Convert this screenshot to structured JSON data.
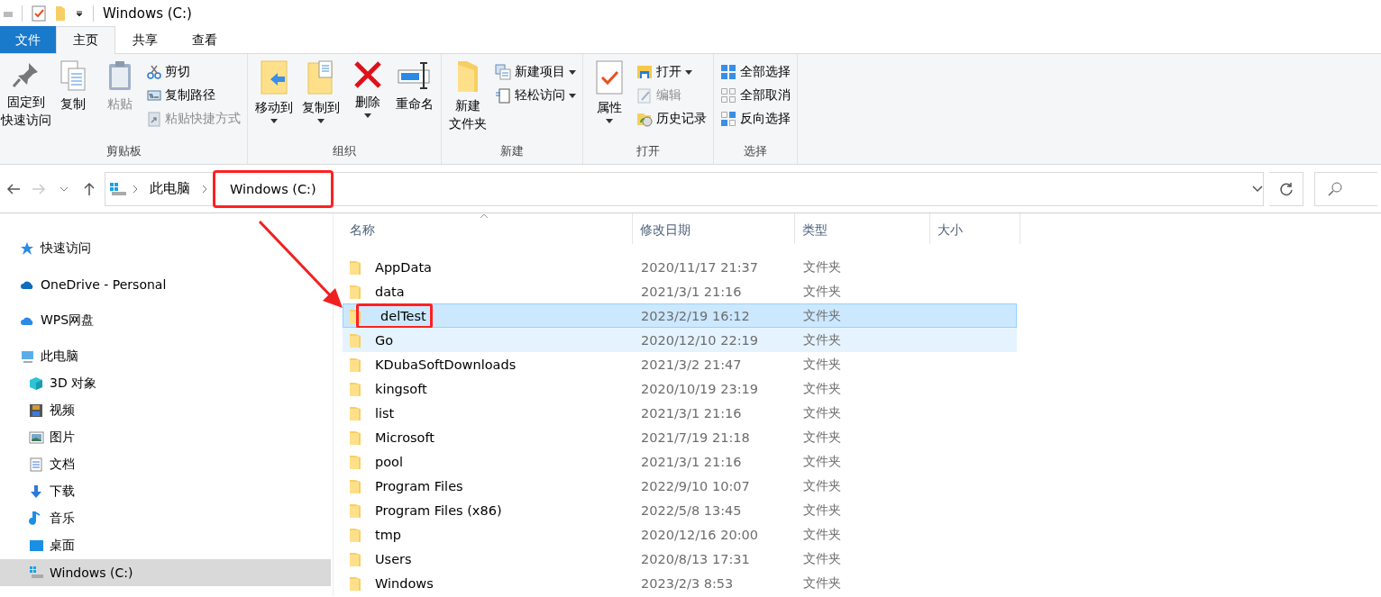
{
  "window": {
    "title": "Windows (C:)"
  },
  "ribbon_tabs": [
    {
      "label": "文件",
      "kind": "file",
      "selected": false
    },
    {
      "label": "主页",
      "kind": "tab",
      "selected": true
    },
    {
      "label": "共享",
      "kind": "tab",
      "selected": false
    },
    {
      "label": "查看",
      "kind": "tab",
      "selected": false
    }
  ],
  "ribbon_groups": [
    {
      "label": "剪贴板",
      "items": [
        {
          "kind": "large",
          "label": [
            "固定到",
            "快速访问"
          ],
          "disabled": false,
          "has_menu": false
        },
        {
          "kind": "large",
          "label": "复制",
          "disabled": false,
          "has_menu": false
        },
        {
          "kind": "large",
          "label": "粘贴",
          "disabled": true,
          "has_menu": false
        },
        {
          "kind": "small",
          "label": "剪切",
          "disabled": false,
          "has_menu": false
        },
        {
          "kind": "small",
          "label": "复制路径",
          "disabled": false,
          "has_menu": false
        },
        {
          "kind": "small",
          "label": "粘贴快捷方式",
          "disabled": true,
          "has_menu": false
        }
      ]
    },
    {
      "label": "组织",
      "items": [
        {
          "kind": "large",
          "label": "移动到",
          "disabled": false,
          "has_menu": true
        },
        {
          "kind": "large",
          "label": "复制到",
          "disabled": false,
          "has_menu": true
        },
        {
          "kind": "large",
          "label": "删除",
          "disabled": false,
          "has_menu": true
        },
        {
          "kind": "large",
          "label": "重命名",
          "disabled": false,
          "has_menu": false
        }
      ]
    },
    {
      "label": "新建",
      "items": [
        {
          "kind": "large",
          "label": [
            "新建",
            "文件夹"
          ],
          "disabled": false,
          "has_menu": false
        },
        {
          "kind": "small",
          "label": "新建项目",
          "disabled": false,
          "has_menu": true
        },
        {
          "kind": "small",
          "label": "轻松访问",
          "disabled": false,
          "has_menu": true
        }
      ]
    },
    {
      "label": "打开",
      "items": [
        {
          "kind": "large",
          "label": "属性",
          "disabled": false,
          "has_menu": true
        },
        {
          "kind": "small",
          "label": "打开",
          "disabled": false,
          "has_menu": true
        },
        {
          "kind": "small",
          "label": "编辑",
          "disabled": true,
          "has_menu": false
        },
        {
          "kind": "small",
          "label": "历史记录",
          "disabled": false,
          "has_menu": false
        }
      ]
    },
    {
      "label": "选择",
      "items": [
        {
          "kind": "small",
          "label": "全部选择",
          "disabled": false,
          "has_menu": false
        },
        {
          "kind": "small",
          "label": "全部取消",
          "disabled": false,
          "has_menu": false
        },
        {
          "kind": "small",
          "label": "反向选择",
          "disabled": false,
          "has_menu": false
        }
      ]
    }
  ],
  "address_bar": {
    "breadcrumbs": [
      {
        "label": "此电脑",
        "annotated": false
      },
      {
        "label": "Windows (C:)",
        "annotated": true
      }
    ]
  },
  "sidebar": {
    "items": [
      {
        "label": "快速访问",
        "selected": false
      },
      {
        "label": "OneDrive - Personal",
        "selected": false
      },
      {
        "label": "WPS网盘",
        "selected": false
      },
      {
        "label": "此电脑",
        "selected": false,
        "children": [
          {
            "label": "3D 对象",
            "selected": false
          },
          {
            "label": "视频",
            "selected": false
          },
          {
            "label": "图片",
            "selected": false
          },
          {
            "label": "文档",
            "selected": false
          },
          {
            "label": "下载",
            "selected": false
          },
          {
            "label": "音乐",
            "selected": false
          },
          {
            "label": "桌面",
            "selected": false
          },
          {
            "label": "Windows (C:)",
            "selected": true
          }
        ]
      }
    ]
  },
  "file_list": {
    "columns": [
      "名称",
      "修改日期",
      "类型",
      "大小"
    ],
    "rows": [
      {
        "name": "AppData",
        "modified": "2020/11/17 21:37",
        "type": "文件夹",
        "selected": false,
        "hovered": false,
        "annotated": false
      },
      {
        "name": "data",
        "modified": "2021/3/1 21:16",
        "type": "文件夹",
        "selected": false,
        "hovered": false,
        "annotated": false
      },
      {
        "name": "delTest",
        "modified": "2023/2/19 16:12",
        "type": "文件夹",
        "selected": true,
        "hovered": false,
        "annotated": true
      },
      {
        "name": "Go",
        "modified": "2020/12/10 22:19",
        "type": "文件夹",
        "selected": false,
        "hovered": true,
        "annotated": false
      },
      {
        "name": "KDubaSoftDownloads",
        "modified": "2021/3/2 21:47",
        "type": "文件夹",
        "selected": false,
        "hovered": false,
        "annotated": false
      },
      {
        "name": "kingsoft",
        "modified": "2020/10/19 23:19",
        "type": "文件夹",
        "selected": false,
        "hovered": false,
        "annotated": false
      },
      {
        "name": "list",
        "modified": "2021/3/1 21:16",
        "type": "文件夹",
        "selected": false,
        "hovered": false,
        "annotated": false
      },
      {
        "name": "Microsoft",
        "modified": "2021/7/19 21:18",
        "type": "文件夹",
        "selected": false,
        "hovered": false,
        "annotated": false
      },
      {
        "name": "pool",
        "modified": "2021/3/1 21:16",
        "type": "文件夹",
        "selected": false,
        "hovered": false,
        "annotated": false
      },
      {
        "name": "Program Files",
        "modified": "2022/9/10 10:07",
        "type": "文件夹",
        "selected": false,
        "hovered": false,
        "annotated": false
      },
      {
        "name": "Program Files (x86)",
        "modified": "2022/5/8 13:45",
        "type": "文件夹",
        "selected": false,
        "hovered": false,
        "annotated": false
      },
      {
        "name": "tmp",
        "modified": "2020/12/16 20:00",
        "type": "文件夹",
        "selected": false,
        "hovered": false,
        "annotated": false
      },
      {
        "name": "Users",
        "modified": "2020/8/13 17:31",
        "type": "文件夹",
        "selected": false,
        "hovered": false,
        "annotated": false
      },
      {
        "name": "Windows",
        "modified": "2023/2/3 8:53",
        "type": "文件夹",
        "selected": false,
        "hovered": false,
        "annotated": false
      }
    ]
  }
}
